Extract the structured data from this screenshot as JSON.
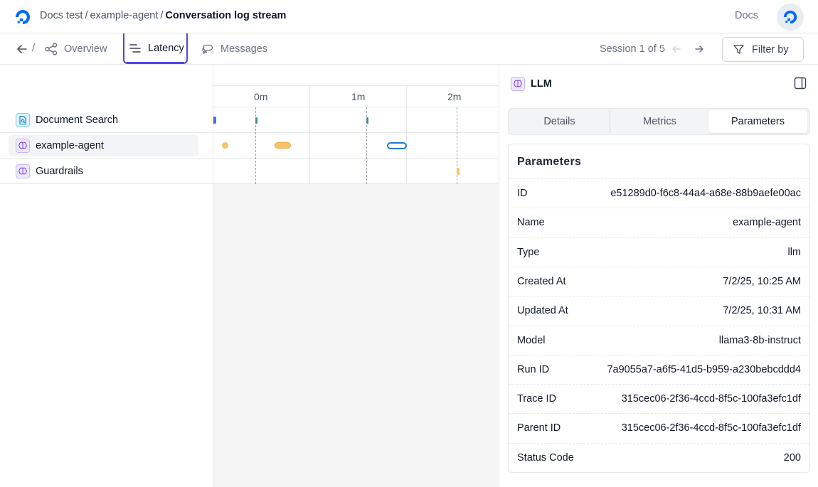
{
  "breadcrumb": {
    "items": [
      "Docs test",
      "example-agent"
    ],
    "current": "Conversation log stream",
    "separator": "/"
  },
  "header": {
    "docs_label": "Docs"
  },
  "tabs": {
    "slash": "/",
    "overview": "Overview",
    "latency": "Latency",
    "messages": "Messages"
  },
  "session": {
    "label": "Session 1 of 5"
  },
  "filter": {
    "label": "Filter by"
  },
  "spans": [
    {
      "name": "Document Search",
      "icon": "document-search-icon"
    },
    {
      "name": "example-agent",
      "icon": "brain-icon"
    },
    {
      "name": "Guardrails",
      "icon": "brain-icon"
    }
  ],
  "timeline": {
    "ticks": [
      "0m",
      "1m",
      "2m"
    ]
  },
  "panel": {
    "title": "LLM",
    "tabs": [
      "Details",
      "Metrics",
      "Parameters"
    ],
    "active_tab": "Parameters",
    "heading": "Parameters",
    "params": [
      {
        "key": "ID",
        "value": "e51289d0-f6c8-44a4-a68e-88b9aefe00ac"
      },
      {
        "key": "Name",
        "value": "example-agent"
      },
      {
        "key": "Type",
        "value": "llm"
      },
      {
        "key": "Created At",
        "value": "7/2/25, 10:25 AM"
      },
      {
        "key": "Updated At",
        "value": "7/2/25, 10:31 AM"
      },
      {
        "key": "Model",
        "value": "llama3-8b-instruct"
      },
      {
        "key": "Run ID",
        "value": "7a9055a7-a6f5-41d5-b959-a230bebcddd4"
      },
      {
        "key": "Trace ID",
        "value": "315cec06-2f36-4ccd-8f5c-100fa3efc1df"
      },
      {
        "key": "Parent ID",
        "value": "315cec06-2f36-4ccd-8f5c-100fa3efc1df"
      },
      {
        "key": "Status Code",
        "value": "200"
      }
    ]
  },
  "colors": {
    "accent": "#4f46e5",
    "brand_blue": "#0069ff",
    "llm_bar": "#f6c36b",
    "tool_bar": "#4a8f8c",
    "search_bar": "#4a6fd1",
    "selected_outline": "#1d7bd8"
  }
}
